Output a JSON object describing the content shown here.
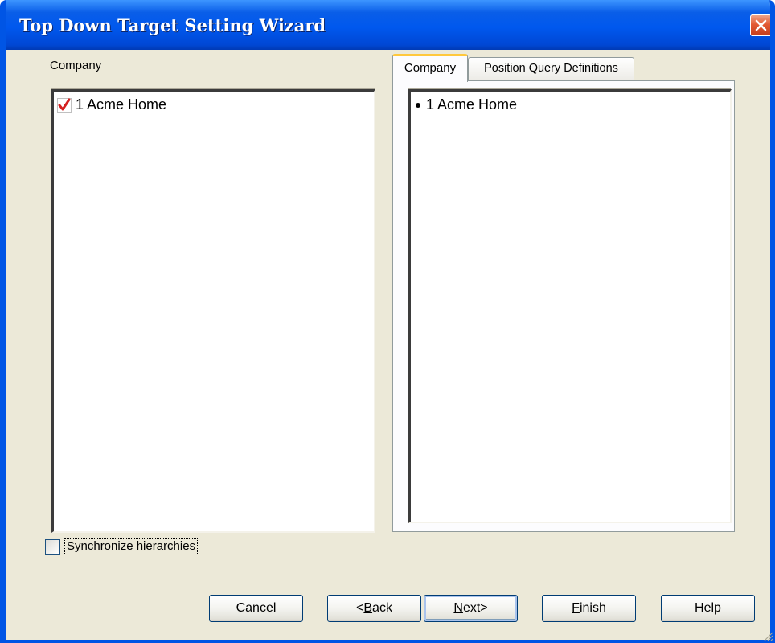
{
  "window": {
    "title": "Top Down Target Setting Wizard",
    "close_icon": "close-icon",
    "accent_color": "#0055e5",
    "close_color": "#e35b34"
  },
  "left_panel": {
    "label": "Company",
    "tree_items": [
      {
        "text": "1 Acme Home",
        "icon": "checkmark-icon",
        "checked": true
      }
    ]
  },
  "right_panel": {
    "tabs": [
      {
        "label": "Company",
        "active": true
      },
      {
        "label": "Position Query Definitions",
        "active": false
      }
    ],
    "list_items": [
      {
        "text": "1 Acme Home",
        "icon": "bullet-icon"
      }
    ]
  },
  "sync": {
    "label": "Synchronize hierarchies",
    "checked": false
  },
  "buttons": {
    "cancel": {
      "label": "Cancel"
    },
    "back": {
      "prefix": "<",
      "mnemonic": "B",
      "rest": "ack"
    },
    "next": {
      "mnemonic": "N",
      "rest": "ext>"
    },
    "finish": {
      "mnemonic": "F",
      "rest": "inish"
    },
    "help": {
      "label": "Help"
    }
  }
}
